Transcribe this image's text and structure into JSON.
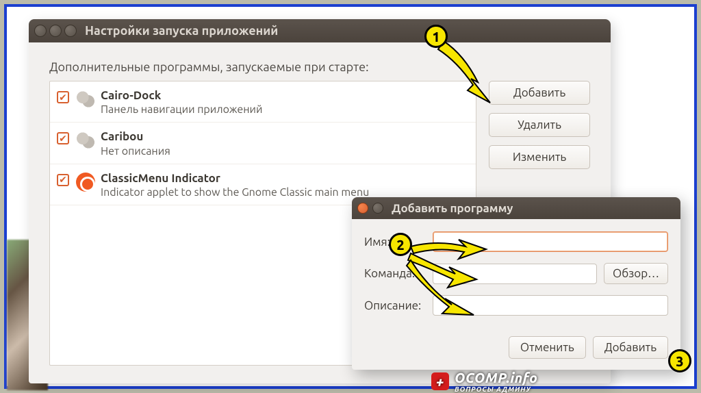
{
  "mainWindow": {
    "title": "Настройки запуска приложений",
    "listLabel": "Дополнительные программы, запускаемые при старте:",
    "items": [
      {
        "name": "Cairo-Dock",
        "desc": "Панель навигации приложений",
        "icon": "gears"
      },
      {
        "name": "Caribou",
        "desc": "Нет описания",
        "icon": "gears"
      },
      {
        "name": "ClassicMenu Indicator",
        "desc": "Indicator applet to show the Gnome Classic main menu",
        "icon": "ubuntu"
      }
    ],
    "buttons": {
      "add": "Добавить",
      "remove": "Удалить",
      "edit": "Изменить"
    }
  },
  "dialog": {
    "title": "Добавить программу",
    "fields": {
      "name": "Имя:",
      "command": "Команда:",
      "desc": "Описание:"
    },
    "browse": "Обзор…",
    "actions": {
      "cancel": "Отменить",
      "add": "Добавить"
    }
  },
  "annotations": {
    "b1": "1",
    "b2": "2",
    "b3": "3"
  },
  "watermark": {
    "brand": "OCOMP.info",
    "sub": "ВОПРОСЫ АДМИНУ"
  }
}
